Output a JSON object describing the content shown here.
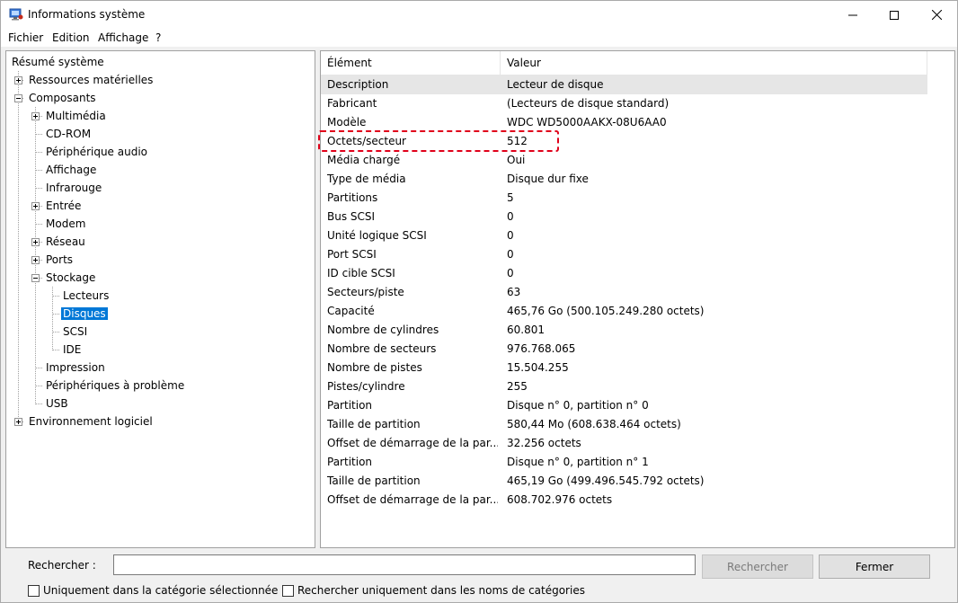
{
  "window": {
    "title": "Informations système"
  },
  "menu": [
    "Fichier",
    "Edition",
    "Affichage",
    "?"
  ],
  "tree": {
    "root": "Résumé système",
    "ressources": "Ressources matérielles",
    "composants": "Composants",
    "multimedia": "Multimédia",
    "cdrom": "CD-ROM",
    "audio": "Périphérique audio",
    "affichage": "Affichage",
    "infrarouge": "Infrarouge",
    "entree": "Entrée",
    "modem": "Modem",
    "reseau": "Réseau",
    "ports": "Ports",
    "stockage": "Stockage",
    "lecteurs": "Lecteurs",
    "disques": "Disques",
    "scsi": "SCSI",
    "ide": "IDE",
    "impression": "Impression",
    "problemes": "Périphériques à problème",
    "usb": "USB",
    "environnement": "Environnement logiciel"
  },
  "list": {
    "headers": [
      "Élément",
      "Valeur"
    ],
    "rows": [
      [
        "Description",
        "Lecteur de disque"
      ],
      [
        "Fabricant",
        "(Lecteurs de disque standard)"
      ],
      [
        "Modèle",
        "WDC WD5000AAKX-08U6AA0"
      ],
      [
        "Octets/secteur",
        "512"
      ],
      [
        "Média chargé",
        "Oui"
      ],
      [
        "Type de média",
        "Disque dur fixe"
      ],
      [
        "Partitions",
        "5"
      ],
      [
        "Bus SCSI",
        "0"
      ],
      [
        "Unité logique SCSI",
        "0"
      ],
      [
        "Port SCSI",
        "0"
      ],
      [
        "ID cible SCSI",
        "0"
      ],
      [
        "Secteurs/piste",
        "63"
      ],
      [
        "Capacité",
        "465,76 Go (500.105.249.280 octets)"
      ],
      [
        "Nombre de cylindres",
        "60.801"
      ],
      [
        "Nombre de secteurs",
        "976.768.065"
      ],
      [
        "Nombre de pistes",
        "15.504.255"
      ],
      [
        "Pistes/cylindre",
        "255"
      ],
      [
        "Partition",
        "Disque n° 0, partition n° 0"
      ],
      [
        "Taille de partition",
        "580,44 Mo (608.638.464 octets)"
      ],
      [
        "Offset de démarrage de la par...",
        "32.256 octets"
      ],
      [
        "Partition",
        "Disque n° 0, partition n° 1"
      ],
      [
        "Taille de partition",
        "465,19 Go (499.496.545.792 octets)"
      ],
      [
        "Offset de démarrage de la par...",
        "608.702.976 octets"
      ]
    ]
  },
  "search": {
    "label": "Rechercher :",
    "value": "",
    "search_button": "Rechercher",
    "close_button": "Fermer",
    "check_selected": "Uniquement dans la catégorie sélectionnée",
    "check_names": "Rechercher uniquement dans les noms de catégories"
  },
  "colors": {
    "selection": "#0078d7",
    "highlight_box": "#e0001a"
  }
}
